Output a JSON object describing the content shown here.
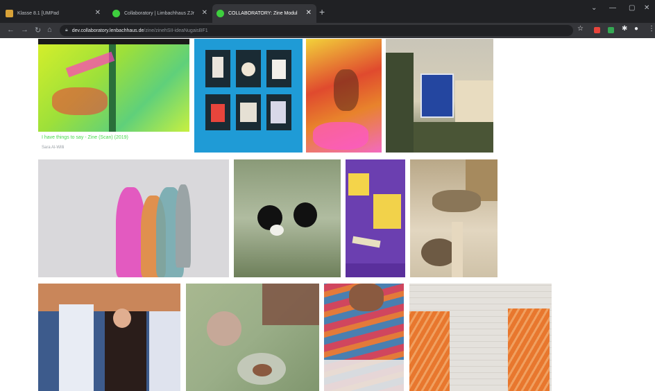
{
  "browser": {
    "tabs": [
      {
        "label": "Klasse 8.1 [UMPad",
        "active": false
      },
      {
        "label": "Collaboratory | Limbachhaus ZJr",
        "active": false
      },
      {
        "label": "COLLABORATORY: Zine Modul",
        "active": true
      }
    ],
    "new_tab": "+",
    "url_host": "dev.collaboratory.lenbachhaus.de",
    "url_path": "/zine/zinehSII-ideaNugaisBF1"
  },
  "gallery": {
    "featured_caption": "I have things to say - Zine (Scan) (2019)",
    "featured_subcaption": "Sara Al-Willi"
  },
  "colors": {
    "caption_green": "#43d94a",
    "tabbar": "#202124",
    "toolbar": "#35363a"
  }
}
